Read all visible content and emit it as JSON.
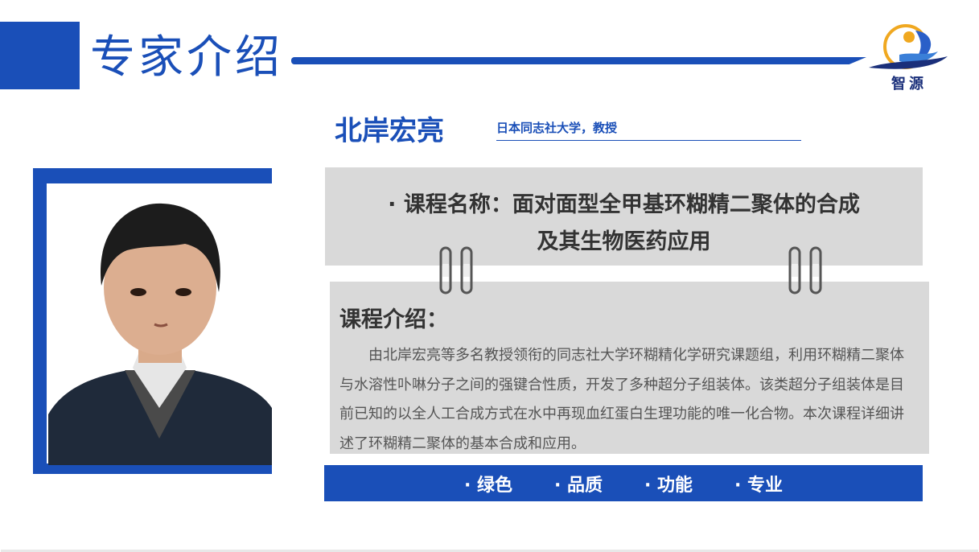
{
  "header": {
    "title": "专家介绍",
    "logo_text": "智源"
  },
  "expert": {
    "name": "北岸宏亮",
    "affiliation": "日本同志社大学，教授"
  },
  "course": {
    "title_line1": "· 课程名称：面对面型全甲基环糊精二聚体的合成",
    "title_line2": "及其生物医药应用"
  },
  "intro": {
    "heading": "课程介绍：",
    "body": "由北岸宏亮等多名教授领衔的同志社大学环糊精化学研究课题组，利用环糊精二聚体与水溶性卟啉分子之间的强键合性质，开发了多种超分子组装体。该类超分子组装体是目前已知的以全人工合成方式在水中再现血红蛋白生理功能的唯一化合物。本次课程详细讲述了环糊精二聚体的基本合成和应用。"
  },
  "tags": [
    "· 绿色",
    "· 品质",
    "· 功能",
    "· 专业"
  ],
  "colors": {
    "accent": "#1a4fb8",
    "box": "#d9d9d9",
    "text": "#333333"
  }
}
